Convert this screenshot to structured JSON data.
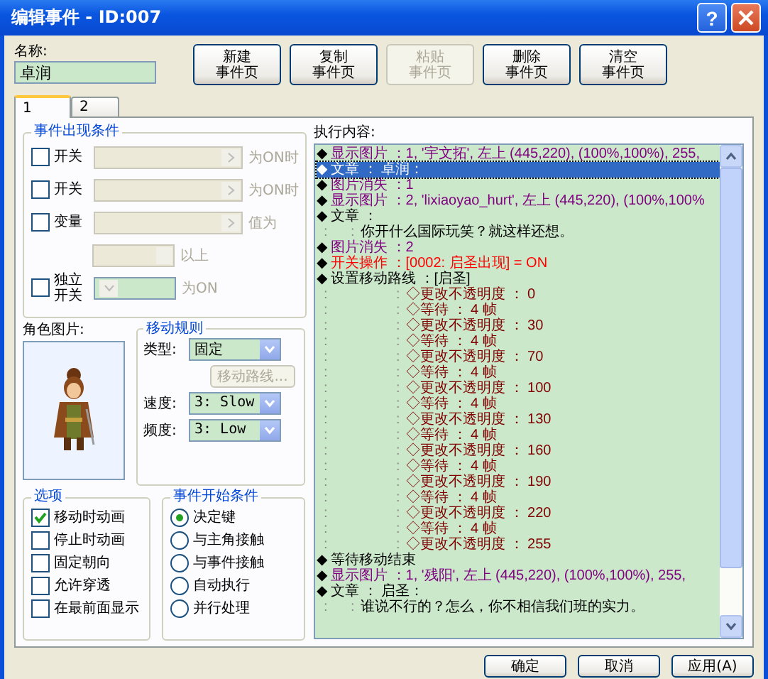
{
  "window": {
    "title": "编辑事件 - ID:007",
    "help": "?"
  },
  "name": {
    "label": "名称:",
    "value": "卓润"
  },
  "page_buttons": [
    {
      "lines": [
        "新建",
        "事件页"
      ],
      "disabled": false
    },
    {
      "lines": [
        "复制",
        "事件页"
      ],
      "disabled": false
    },
    {
      "lines": [
        "粘贴",
        "事件页"
      ],
      "disabled": true
    },
    {
      "lines": [
        "删除",
        "事件页"
      ],
      "disabled": false
    },
    {
      "lines": [
        "清空",
        "事件页"
      ],
      "disabled": false
    }
  ],
  "tabs": [
    {
      "label": "1",
      "selected": true
    },
    {
      "label": "2",
      "selected": false
    }
  ],
  "conditions": {
    "title": "事件出现条件",
    "rows": [
      {
        "kind": "select",
        "label": "开关",
        "checked": false,
        "suffix": "为ON时"
      },
      {
        "kind": "select",
        "label": "开关",
        "checked": false,
        "suffix": "为ON时"
      },
      {
        "kind": "select",
        "label": "变量",
        "checked": false,
        "suffix": "值为"
      },
      {
        "kind": "spin",
        "suffix": "以上"
      },
      {
        "kind": "combo",
        "label_lines": [
          "独立",
          "开关"
        ],
        "checked": false,
        "suffix": "为ON"
      }
    ]
  },
  "graphic": {
    "label": "角色图片:"
  },
  "move": {
    "title": "移动规则",
    "type": {
      "label": "类型:",
      "value": "固定"
    },
    "route_button": {
      "label": "移动路线...",
      "disabled": true
    },
    "speed": {
      "label": "速度:",
      "value": "3: Slow"
    },
    "frequency": {
      "label": "频度:",
      "value": "3: Low"
    }
  },
  "options": {
    "title": "选项",
    "items": [
      {
        "label": "移动时动画",
        "checked": true
      },
      {
        "label": "停止时动画",
        "checked": false
      },
      {
        "label": "固定朝向",
        "checked": false
      },
      {
        "label": "允许穿透",
        "checked": false
      },
      {
        "label": "在最前面显示",
        "checked": false
      }
    ]
  },
  "trigger": {
    "title": "事件开始条件",
    "items": [
      {
        "label": "决定键",
        "selected": true
      },
      {
        "label": "与主角接触",
        "selected": false
      },
      {
        "label": "与事件接触",
        "selected": false
      },
      {
        "label": "自动执行",
        "selected": false
      },
      {
        "label": "并行处理",
        "selected": false
      }
    ]
  },
  "commands": {
    "label": "执行内容:",
    "lines": [
      {
        "kind": "picture",
        "selected": false,
        "bullet": "◆",
        "text": "显示图片 ：1, '宇文拓', 左上 (445,220), (100%,100%), 255,"
      },
      {
        "kind": "message",
        "selected": true,
        "bullet": "◆",
        "text": "文章 ： 卓润："
      },
      {
        "kind": "picture",
        "selected": false,
        "bullet": "◆",
        "text": "图片消失 ：1"
      },
      {
        "kind": "picture",
        "selected": false,
        "bullet": "◆",
        "text": "显示图片 ：2, 'lixiaoyao_hurt', 左上 (445,220), (100%,100%"
      },
      {
        "kind": "message",
        "selected": false,
        "bullet": "◆",
        "text": "文章 ："
      },
      {
        "kind": "cont",
        "selected": false,
        "lead": ":",
        "sep": ":",
        "text": "你开什么国际玩笑？就这样还想。"
      },
      {
        "kind": "picture",
        "selected": false,
        "bullet": "◆",
        "text": "图片消失 ：2"
      },
      {
        "kind": "switch",
        "selected": false,
        "bullet": "◆",
        "text": "开关操作 ：[0002: 启圣出现] = ON"
      },
      {
        "kind": "message",
        "selected": false,
        "bullet": "◆",
        "text": "设置移动路线 ：[启圣]"
      },
      {
        "kind": "step",
        "selected": false,
        "lead": ":",
        "sep": ":",
        "text": "◇更改不透明度 ： 0"
      },
      {
        "kind": "step",
        "selected": false,
        "lead": ":",
        "sep": ":",
        "text": "◇等待 ： 4 帧"
      },
      {
        "kind": "step",
        "selected": false,
        "lead": ":",
        "sep": ":",
        "text": "◇更改不透明度 ： 30"
      },
      {
        "kind": "step",
        "selected": false,
        "lead": ":",
        "sep": ":",
        "text": "◇等待 ： 4 帧"
      },
      {
        "kind": "step",
        "selected": false,
        "lead": ":",
        "sep": ":",
        "text": "◇更改不透明度 ： 70"
      },
      {
        "kind": "step",
        "selected": false,
        "lead": ":",
        "sep": ":",
        "text": "◇等待 ： 4 帧"
      },
      {
        "kind": "step",
        "selected": false,
        "lead": ":",
        "sep": ":",
        "text": "◇更改不透明度 ： 100"
      },
      {
        "kind": "step",
        "selected": false,
        "lead": ":",
        "sep": ":",
        "text": "◇等待 ： 4 帧"
      },
      {
        "kind": "step",
        "selected": false,
        "lead": ":",
        "sep": ":",
        "text": "◇更改不透明度 ： 130"
      },
      {
        "kind": "step",
        "selected": false,
        "lead": ":",
        "sep": ":",
        "text": "◇等待 ： 4 帧"
      },
      {
        "kind": "step",
        "selected": false,
        "lead": ":",
        "sep": ":",
        "text": "◇更改不透明度 ： 160"
      },
      {
        "kind": "step",
        "selected": false,
        "lead": ":",
        "sep": ":",
        "text": "◇等待 ： 4 帧"
      },
      {
        "kind": "step",
        "selected": false,
        "lead": ":",
        "sep": ":",
        "text": "◇更改不透明度 ： 190"
      },
      {
        "kind": "step",
        "selected": false,
        "lead": ":",
        "sep": ":",
        "text": "◇等待 ： 4 帧"
      },
      {
        "kind": "step",
        "selected": false,
        "lead": ":",
        "sep": ":",
        "text": "◇更改不透明度 ： 220"
      },
      {
        "kind": "step",
        "selected": false,
        "lead": ":",
        "sep": ":",
        "text": "◇等待 ： 4 帧"
      },
      {
        "kind": "step",
        "selected": false,
        "lead": ":",
        "sep": ":",
        "text": "◇更改不透明度 ： 255"
      },
      {
        "kind": "message",
        "selected": false,
        "bullet": "◆",
        "text": "等待移动结束"
      },
      {
        "kind": "picture",
        "selected": false,
        "bullet": "◆",
        "text": "显示图片 ：1, '残阳', 左上 (445,220), (100%,100%), 255,"
      },
      {
        "kind": "message",
        "selected": false,
        "bullet": "◆",
        "text": "文章 ： 启圣："
      },
      {
        "kind": "cont",
        "selected": false,
        "lead": ":",
        "sep": ":",
        "text": "谁说不行的？怎么，你不相信我们班的实力。"
      }
    ]
  },
  "buttons": [
    {
      "label": "确定"
    },
    {
      "label": "取消"
    },
    {
      "label": "应用(A)"
    }
  ]
}
